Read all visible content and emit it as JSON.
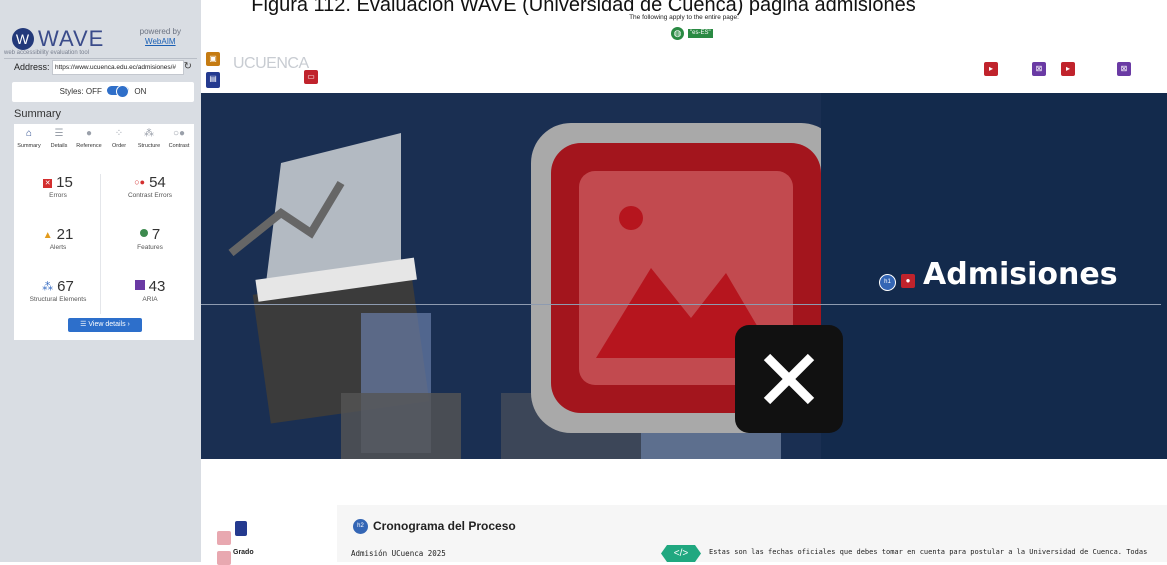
{
  "caption": "Figura 112. Evaluación WAVE (Universidad de Cuenca) página admisiones",
  "wave": {
    "logo": "WAVE",
    "tagline": "web accessibility evaluation tool",
    "powered_by": "powered by",
    "webaim": "WebAIM",
    "address_label": "Address:",
    "address_value": "https://www.ucuenca.edu.ec/admisiones/#",
    "styles_label": "Styles:",
    "styles_off": "OFF",
    "styles_on": "ON",
    "summary_title": "Summary",
    "tabs": [
      {
        "label": "Summary",
        "icon": "home-icon"
      },
      {
        "label": "Details",
        "icon": "list-icon"
      },
      {
        "label": "Reference",
        "icon": "info-icon"
      },
      {
        "label": "Order",
        "icon": "order-icon"
      },
      {
        "label": "Structure",
        "icon": "structure-icon"
      },
      {
        "label": "Contrast",
        "icon": "contrast-icon"
      }
    ],
    "stats": {
      "errors": {
        "value": "15",
        "label": "Errors"
      },
      "contrast": {
        "value": "54",
        "label": "Contrast Errors"
      },
      "alerts": {
        "value": "21",
        "label": "Alerts"
      },
      "features": {
        "value": "7",
        "label": "Features"
      },
      "structural": {
        "value": "67",
        "label": "Structural Elements"
      },
      "aria": {
        "value": "43",
        "label": "ARIA"
      }
    },
    "view_details": "View details ›"
  },
  "page": {
    "entire_page_note": "The following apply to the entire page:",
    "lang_badge": "\"es-ES\"",
    "site_name": "UCUENCA",
    "hero_title": "Admisiones",
    "h1_badge": "h1",
    "h2_badge": "h2",
    "section_heading": "Cronograma del Proceso",
    "admision_label": "Admisión UCuenca 2025",
    "grado_label": "Grado",
    "code_icon": "</>",
    "intro_text": "Estas son las fechas oficiales que debes tomar en cuenta para postular a la Universidad de Cuenca. Todas las etapas"
  },
  "colors": {
    "error": "#d32f2f",
    "alert": "#e39b1c",
    "feature": "#3d8a4e",
    "aria": "#6a3aa4",
    "hero_bg": "#132a4c"
  }
}
